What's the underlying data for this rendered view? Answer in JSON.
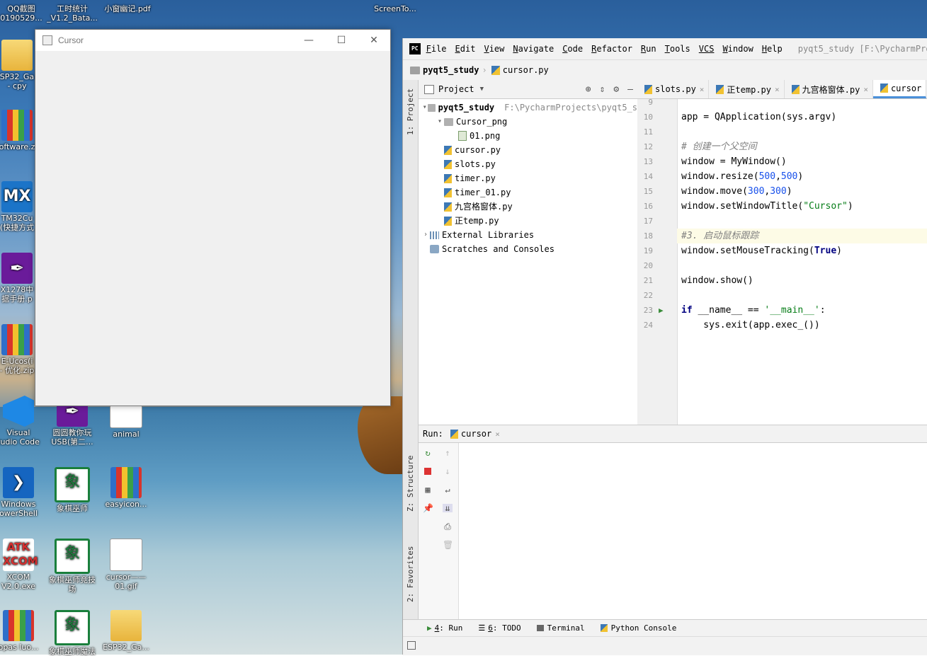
{
  "desktop": {
    "top_labels": [
      {
        "id": "qq",
        "text": "QQ截图"
      },
      {
        "id": "qq2",
        "text": "0190529..."
      },
      {
        "id": "gs",
        "text": "工时统计"
      },
      {
        "id": "gs2",
        "text": "_V1.2_Bata..."
      },
      {
        "id": "pdf",
        "text": "小窗幽记.pdf"
      },
      {
        "id": "sc",
        "text": "ScreenTo..."
      }
    ],
    "icons": [
      {
        "label1": "SP32_Ga",
        "label2": "- cpy"
      },
      {
        "label1": "oftware.z",
        "label2": ""
      },
      {
        "label1": "TM32Cu",
        "label2": "(快捷方式"
      },
      {
        "label1": "X1278中",
        "label2": "据手册.p"
      },
      {
        "label1": "E-Ucos(i",
        "label2": "- 优化.zip"
      },
      {
        "label1": "Visual",
        "label2": "tudio Code"
      },
      {
        "label1": "圆圆教你玩",
        "label2": "USB(第二..."
      },
      {
        "label1": "animal",
        "label2": ""
      },
      {
        "label1": "Windows",
        "label2": "owerShell"
      },
      {
        "label1": "象棋巫师",
        "label2": ""
      },
      {
        "label1": "easyicon...",
        "label2": ""
      },
      {
        "label1": "XCOM",
        "label2": "V2.0.exe"
      },
      {
        "label1": "象棋巫师竞技",
        "label2": "场"
      },
      {
        "label1": "cursor——",
        "label2": "01.gif"
      },
      {
        "label1": "opas luo...",
        "label2": ""
      },
      {
        "label1": "象棋巫师魔法",
        "label2": ""
      },
      {
        "label1": "ESP32_Ga...",
        "label2": ""
      }
    ],
    "icon_glyphs": {
      "mx": "MX",
      "atk": "ATK",
      "xcom": "XCOM",
      "xiang": "象"
    }
  },
  "cursor_window": {
    "title": "Cursor",
    "minimize": "—",
    "maximize": "☐",
    "close": "✕"
  },
  "pycharm": {
    "logo": "PC",
    "menu": [
      {
        "u": "F",
        "rest": "ile"
      },
      {
        "u": "E",
        "rest": "dit"
      },
      {
        "u": "V",
        "rest": "iew"
      },
      {
        "u": "N",
        "rest": "avigate"
      },
      {
        "u": "C",
        "rest": "ode"
      },
      {
        "u": "R",
        "rest": "efactor"
      },
      {
        "u": "R",
        "rest": "un"
      },
      {
        "u": "T",
        "rest": "ools"
      },
      {
        "u": "VCS",
        "rest": ""
      },
      {
        "u": "W",
        "rest": "indow"
      },
      {
        "u": "H",
        "rest": "elp"
      }
    ],
    "project_title": "pyqt5_study [F:\\PycharmPro",
    "breadcrumb": {
      "project": "pyqt5_study",
      "file": "cursor.py"
    },
    "side_tabs": {
      "project": "1: Project",
      "structure": "Z: Structure",
      "favorites": "2: Favorites"
    },
    "project_panel": {
      "header": "Project",
      "tree": [
        {
          "indent": 0,
          "arrow": "▾",
          "icon": "folder",
          "text": "pyqt5_study",
          "bold": true,
          "path": "F:\\PycharmProjects\\pyqt5_s"
        },
        {
          "indent": 1,
          "arrow": "▾",
          "icon": "folder",
          "text": "Cursor_png"
        },
        {
          "indent": 2,
          "arrow": "",
          "icon": "image",
          "text": "01.png"
        },
        {
          "indent": 1,
          "arrow": "",
          "icon": "py",
          "text": "cursor.py"
        },
        {
          "indent": 1,
          "arrow": "",
          "icon": "py",
          "text": "slots.py"
        },
        {
          "indent": 1,
          "arrow": "",
          "icon": "py",
          "text": "timer.py"
        },
        {
          "indent": 1,
          "arrow": "",
          "icon": "py",
          "text": "timer_01.py"
        },
        {
          "indent": 1,
          "arrow": "",
          "icon": "py",
          "text": "九宫格窗体.py"
        },
        {
          "indent": 1,
          "arrow": "",
          "icon": "py",
          "text": "正temp.py"
        },
        {
          "indent": 0,
          "arrow": "›",
          "icon": "lib",
          "text": "External Libraries"
        },
        {
          "indent": 0,
          "arrow": "",
          "icon": "scratch",
          "text": "Scratches and Consoles"
        }
      ]
    },
    "editor_tabs": [
      {
        "label": "slots.py",
        "close": "×",
        "active": false
      },
      {
        "label": "正temp.py",
        "close": "×",
        "active": false
      },
      {
        "label": "九宫格窗体.py",
        "close": "×",
        "active": false
      },
      {
        "label": "cursor",
        "close": "",
        "active": true
      }
    ],
    "code_lines": [
      {
        "n": "9",
        "segs": []
      },
      {
        "n": "10",
        "segs": [
          {
            "t": "app = QApplication(sys.argv)",
            "c": ""
          }
        ]
      },
      {
        "n": "11",
        "segs": []
      },
      {
        "n": "12",
        "segs": [
          {
            "t": "# 创建一个父空间",
            "c": "comment"
          }
        ]
      },
      {
        "n": "13",
        "segs": [
          {
            "t": "window = MyWindow()",
            "c": ""
          }
        ]
      },
      {
        "n": "14",
        "segs": [
          {
            "t": "window.resize(",
            "c": ""
          },
          {
            "t": "500",
            "c": "num"
          },
          {
            "t": ",",
            "c": ""
          },
          {
            "t": "500",
            "c": "num"
          },
          {
            "t": ")",
            "c": ""
          }
        ]
      },
      {
        "n": "15",
        "segs": [
          {
            "t": "window.move(",
            "c": ""
          },
          {
            "t": "300",
            "c": "num"
          },
          {
            "t": ",",
            "c": ""
          },
          {
            "t": "300",
            "c": "num"
          },
          {
            "t": ")",
            "c": ""
          }
        ]
      },
      {
        "n": "16",
        "segs": [
          {
            "t": "window.setWindowTitle(",
            "c": ""
          },
          {
            "t": "\"Cursor\"",
            "c": "str"
          },
          {
            "t": ")",
            "c": ""
          }
        ]
      },
      {
        "n": "17",
        "segs": []
      },
      {
        "n": "18",
        "segs": [
          {
            "t": "#3. 启动鼠标跟踪",
            "c": "comment"
          }
        ]
      },
      {
        "n": "19",
        "segs": [
          {
            "t": "window.setMouseTracking(",
            "c": ""
          },
          {
            "t": "True",
            "c": "kw"
          },
          {
            "t": ")",
            "c": ""
          }
        ]
      },
      {
        "n": "20",
        "segs": []
      },
      {
        "n": "21",
        "segs": [
          {
            "t": "window.show()",
            "c": ""
          }
        ]
      },
      {
        "n": "22",
        "segs": []
      },
      {
        "n": "23",
        "segs": [
          {
            "t": "if",
            "c": "kw"
          },
          {
            "t": " __name__ == ",
            "c": ""
          },
          {
            "t": "'__main__'",
            "c": "str"
          },
          {
            "t": ":",
            "c": ""
          }
        ]
      },
      {
        "n": "24",
        "segs": [
          {
            "t": "    sys.exit(app.exec_())",
            "c": ""
          }
        ]
      }
    ],
    "run_panel": {
      "label": "Run:",
      "tab": "cursor",
      "close": "×"
    },
    "status_tabs": [
      {
        "key": "4",
        "label": ": Run"
      },
      {
        "key": "6",
        "label": ": TODO"
      },
      {
        "key": "",
        "label": "Terminal"
      },
      {
        "key": "",
        "label": "Python Console"
      }
    ]
  }
}
